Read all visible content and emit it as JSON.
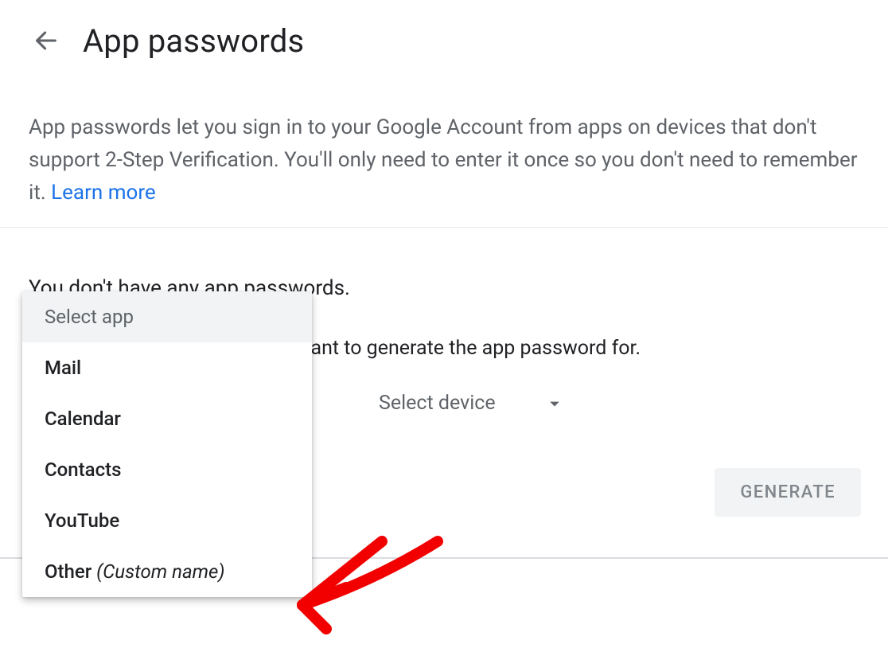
{
  "header": {
    "title": "App passwords"
  },
  "description": {
    "text": "App passwords let you sign in to your Google Account from apps on devices that don't support 2-Step Verification. You'll only need to enter it once so you don't need to remember it. ",
    "learn_more": "Learn more"
  },
  "empty_state": "You don't have any app passwords.",
  "instruction_suffix": "u want to generate the app password for.",
  "device_selector": {
    "label": "Select device"
  },
  "generate_button": "GENERATE",
  "dropdown": {
    "header": "Select app",
    "options": [
      {
        "label": "Mail"
      },
      {
        "label": "Calendar"
      },
      {
        "label": "Contacts"
      },
      {
        "label": "YouTube"
      },
      {
        "label": "Other ",
        "hint": "(Custom name)"
      }
    ]
  }
}
